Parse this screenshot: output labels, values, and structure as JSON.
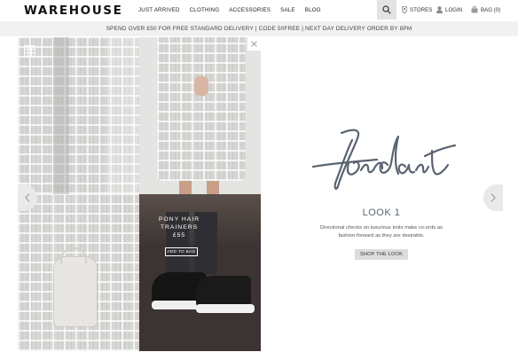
{
  "header": {
    "logo": "WAREHOUSE",
    "nav": [
      "JUST ARRIVED",
      "CLOTHING",
      "ACCESSORIES",
      "SALE",
      "BLOG"
    ],
    "stores_label": "STORES",
    "login_label": "LOGIN",
    "bag_label": "BAG (0)"
  },
  "promo": {
    "text": "SPEND OVER £50 FOR FREE STANDARD DELIVERY  |  CODE 50FREE  |  NEXT DAY DELIVERY ORDER BY 8PM"
  },
  "gallery": {
    "product_line1": "PONY HAIR",
    "product_line2": "TRAINERS",
    "product_price": "£55",
    "add_to_bag": "ADD TO BAG"
  },
  "look": {
    "script_text": "fondant",
    "title": "LOOK 1",
    "desc_line1": "Directional checks on luxurious knits make co-ords as",
    "desc_line2": "fashion-forward as they are desirable.",
    "shop_button": "SHOP THE LOOK"
  },
  "colors": {
    "accent": "#5a6470",
    "promo_bg": "#f1f1f1",
    "search_bg": "#e3e3e3",
    "button_bg": "#dcdcdc"
  },
  "icons": [
    "search-icon",
    "pin-icon",
    "user-icon",
    "bag-icon",
    "grid-icon",
    "close-icon",
    "chevron-left-icon",
    "chevron-right-icon"
  ]
}
